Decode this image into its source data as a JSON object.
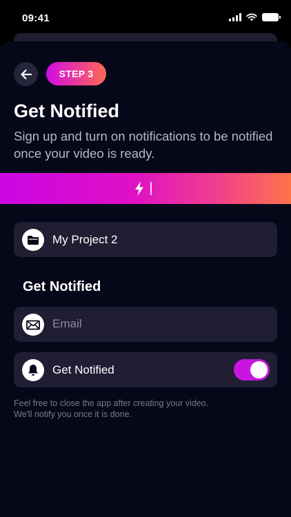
{
  "status_bar": {
    "time": "09:41"
  },
  "header": {
    "step_label": "STEP 3",
    "title": "Get Notified",
    "subtitle": "Sign up and turn on notifications to be notified once your video is ready."
  },
  "project": {
    "name": "My Project 2",
    "icon": "folder-icon"
  },
  "notify_section": {
    "title": "Get Notified",
    "email": {
      "value": "",
      "placeholder": "Email",
      "icon": "envelope-icon"
    },
    "toggle": {
      "label": "Get Notified",
      "enabled": true,
      "icon": "bell-icon"
    }
  },
  "footnote": {
    "line1": "Feel free to close the app after creating your video.",
    "line2": "We'll notify you once it is done."
  },
  "colors": {
    "accent_magenta": "#cc06e2",
    "accent_orange": "#ff744a",
    "background": "#07071a",
    "row_background": "#1f1e33"
  }
}
